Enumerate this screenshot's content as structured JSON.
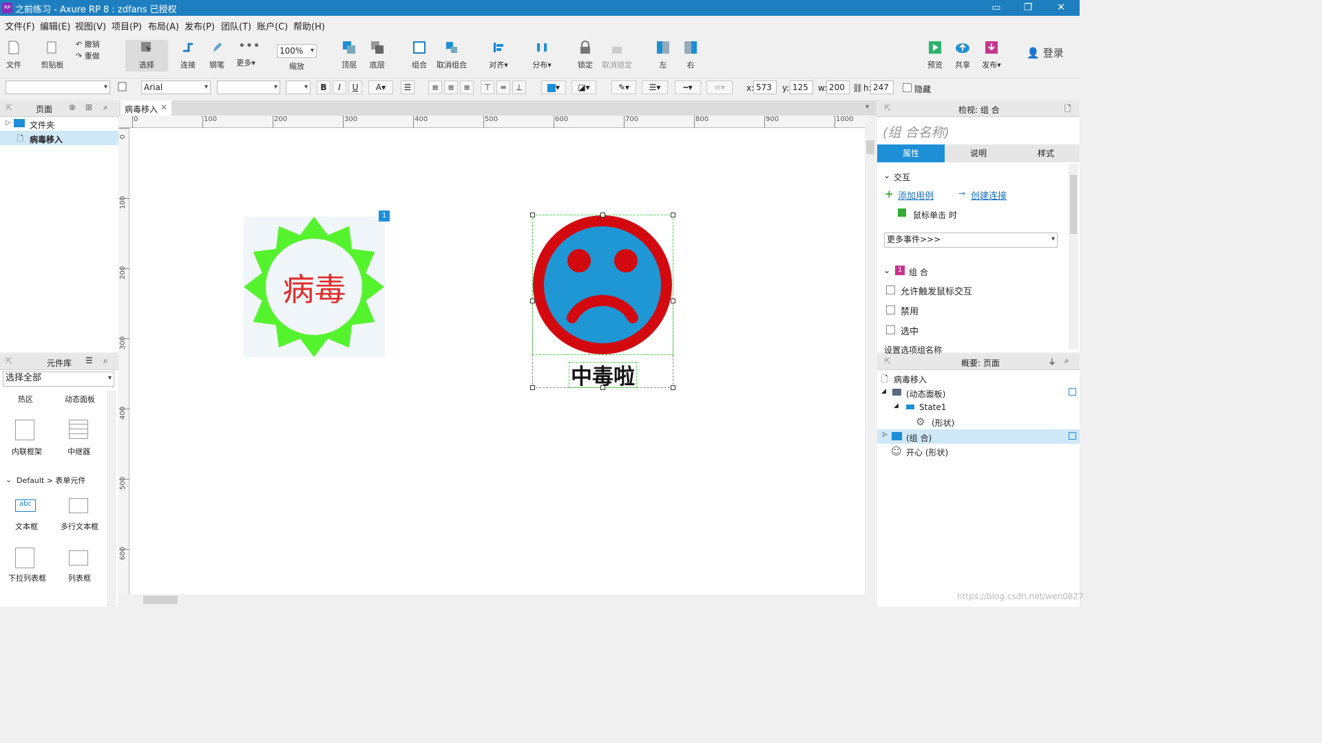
{
  "window": {
    "title": "之前练习 - Axure RP 8 : zdfans 已授权",
    "app_badge": "RP"
  },
  "menu": [
    "文件(F)",
    "编辑(E)",
    "视图(V)",
    "项目(P)",
    "布局(A)",
    "发布(P)",
    "团队(T)",
    "账户(C)",
    "帮助(H)"
  ],
  "toolbar": {
    "file": "文件",
    "clipboard": "剪贴板",
    "undo": "撤销",
    "redo": "重做",
    "select": "选择",
    "connect": "连接",
    "pen": "钢笔",
    "more": "更多▾",
    "zoom_value": "100%",
    "zoom_label": "缩放",
    "top_layer": "顶层",
    "bottom_layer": "底层",
    "group": "组合",
    "ungroup": "取消组合",
    "align": "对齐▾",
    "distribute": "分布▾",
    "lock": "锁定",
    "unlock": "取消锁定",
    "left": "左",
    "right": "右",
    "preview": "预览",
    "share": "共享",
    "publish": "发布▾",
    "login": "登录"
  },
  "format": {
    "font": "Arial",
    "x_label": "x:",
    "x": "573",
    "y_label": "y:",
    "y": "125",
    "w_label": "w:",
    "w": "200",
    "h_label": "h:",
    "h": "247",
    "hidden": "隐藏"
  },
  "pages_panel": {
    "title": "页面",
    "folder": "文件夹",
    "page": "病毒移入"
  },
  "library_panel": {
    "title": "元件库",
    "select": "选择全部",
    "items": [
      "热区",
      "动态面板",
      "内联框架",
      "中继器"
    ],
    "section": "Default > 表单元件",
    "form_items": [
      "文本框",
      "多行文本框",
      "下拉列表框",
      "列表框"
    ]
  },
  "tab": {
    "label": "病毒移入"
  },
  "ruler_h": [
    "0",
    "100",
    "200",
    "300",
    "400",
    "500",
    "600",
    "700",
    "800",
    "900",
    "1000"
  ],
  "ruler_v": [
    "0",
    "100",
    "200",
    "300",
    "400",
    "500",
    "600"
  ],
  "canvas": {
    "virus_text": "病毒",
    "badge": "1",
    "sad_text": "中毒啦"
  },
  "inspector": {
    "title": "检视: 组 合",
    "name_placeholder": "(组 合名称)",
    "tabs": [
      "属性",
      "说明",
      "样式"
    ],
    "interaction": "交互",
    "add_case": "添加用例",
    "create_link": "创建连接",
    "on_click": "鼠标单击 时",
    "more_events": "更多事件>>>",
    "group_label": "组 合",
    "group_badge": "1",
    "allow_mouse": "允许触发鼠标交互",
    "disable": "禁用",
    "selected": "选中",
    "option_group": "设置选项组名称"
  },
  "outline": {
    "title": "概要: 页面",
    "page": "病毒移入",
    "dynamic_panel": "(动态面板)",
    "state": "State1",
    "shape": "(形状)",
    "group": "(组 合)",
    "happy": "开心 (形状)"
  },
  "watermark": "https://blog.csdn.net/wen0627",
  "colors": {
    "titlebar": "#1e7fc0",
    "accent": "#1c8fd6",
    "virus_green": "#55f32e",
    "sad_red": "#d20a10",
    "sad_blue": "#1f97d4"
  }
}
